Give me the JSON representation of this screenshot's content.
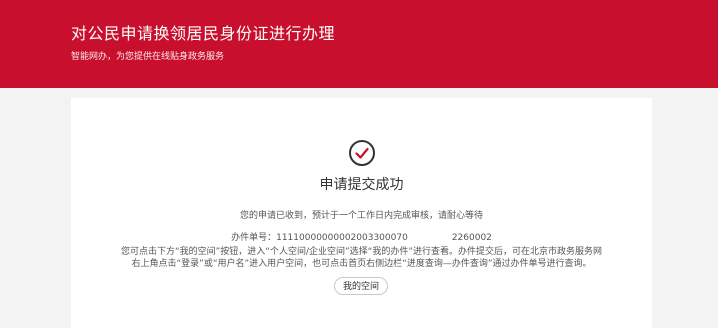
{
  "header": {
    "title": "对公民申请换领居民身份证进行办理",
    "subtitle": "智能网办，为您提供在线贴身政务服务",
    "bg_color": "#c8102e"
  },
  "result": {
    "icon": "check-circle-icon",
    "title": "申请提交成功",
    "received_text": "您的申请已收到，预计于一个工作日内完成审核，请耐心等待",
    "application_number_label": "办件单号：",
    "application_number_visible": "11110000000002003300070",
    "application_number_tail": "2260002",
    "instruction_line1": "您可点击下方“我的空间”按钮，进入“个人空间/企业空间”选择“我的办件”进行查看。办件提交后，可在北京市政务服务网",
    "instruction_line2": "右上角点击“登录”或“用户名”进入用户空间，也可点击首页右侧边栏“进度查询—办件查询”通过办件单号进行查询。",
    "my_space_button": "我的空间"
  }
}
